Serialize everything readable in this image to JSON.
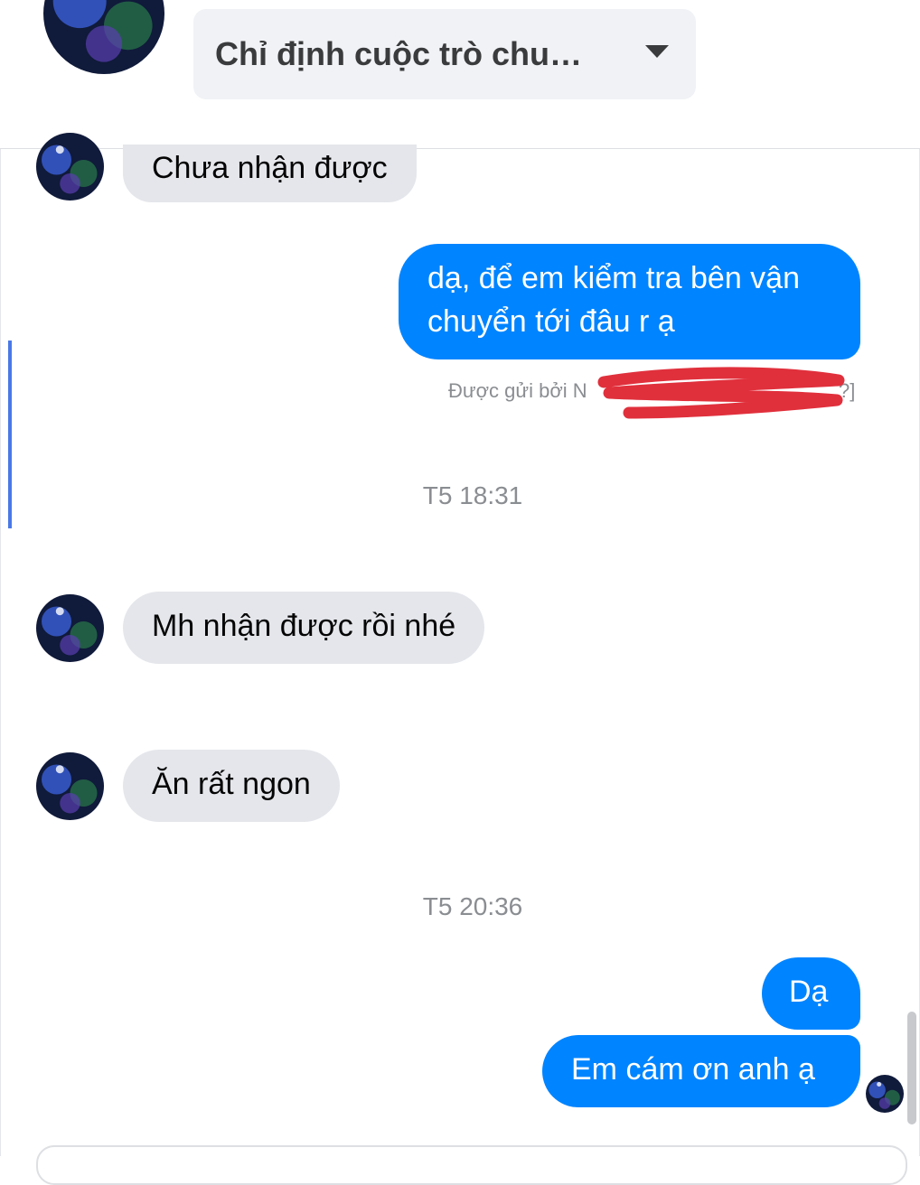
{
  "header": {
    "assign_label": "Chỉ định cuộc trò chu…"
  },
  "messages": [
    {
      "id": "m1",
      "text": "Chưa nhận được"
    },
    {
      "id": "m2",
      "text_lines": [
        "dạ, để em kiểm tra bên vận",
        "chuyển tới đâu r ạ"
      ]
    },
    {
      "id": "m3",
      "text": "Mh nhận được rồi nhé"
    },
    {
      "id": "m4",
      "text": "Ăn rất ngon"
    },
    {
      "id": "m5",
      "text": "Dạ"
    },
    {
      "id": "m6",
      "text": "Em cám ơn anh ạ"
    }
  ],
  "sent_by": {
    "prefix": "Được gửi bởi N",
    "suffix": "?]"
  },
  "timestamps": [
    "T5 18:31",
    "T5 20:36"
  ],
  "colors": {
    "outgoing_bubble": "#0084ff",
    "incoming_bubble": "#e4e6eb",
    "redaction_mark": "#e0303c"
  }
}
